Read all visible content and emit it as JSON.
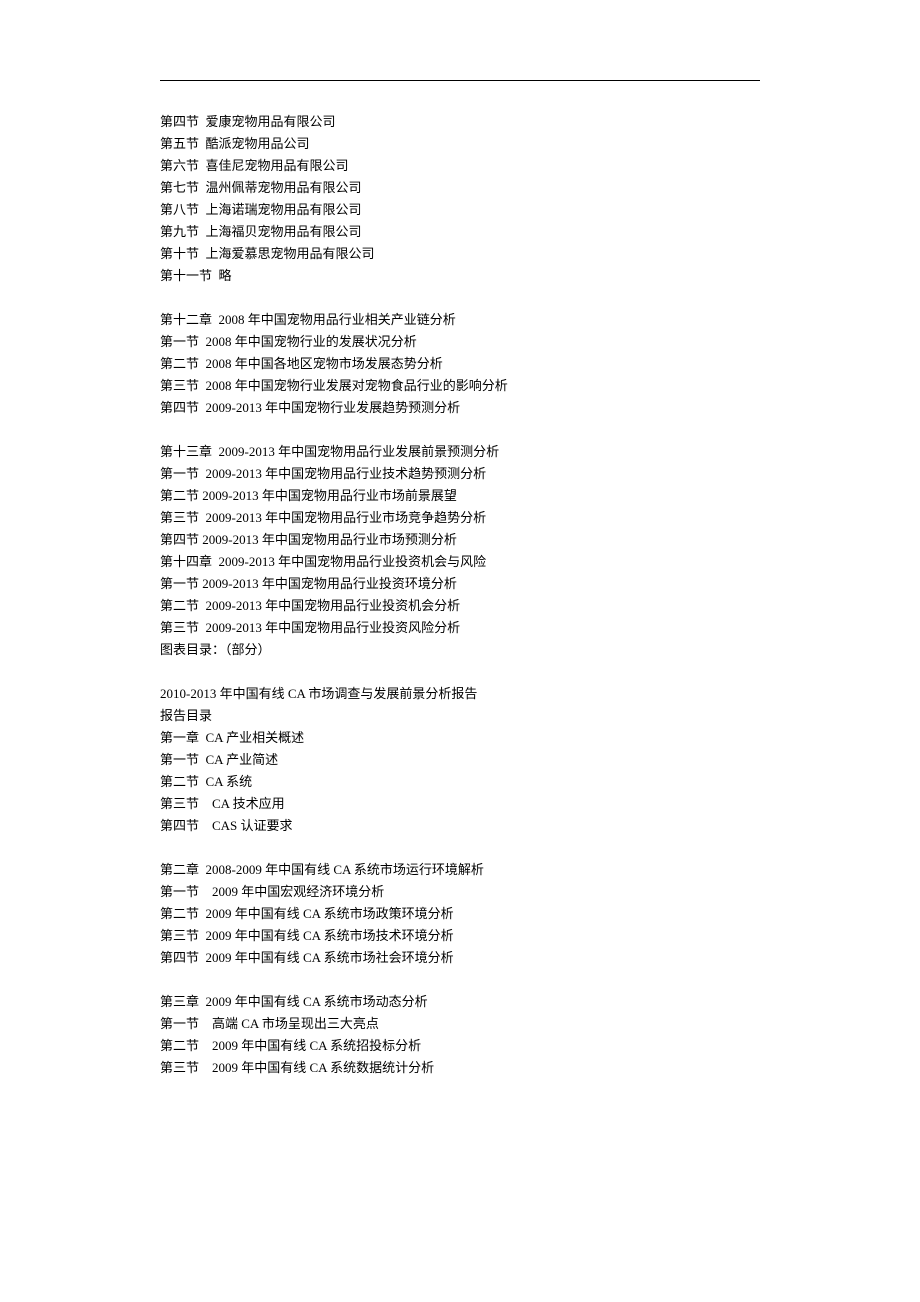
{
  "lines": [
    "第四节  爱康宠物用品有限公司",
    "第五节  酷派宠物用品公司",
    "第六节  喜佳尼宠物用品有限公司",
    "第七节  温州佩蒂宠物用品有限公司",
    "第八节  上海诺瑞宠物用品有限公司",
    "第九节  上海福贝宠物用品有限公司",
    "第十节  上海爱慕思宠物用品有限公司",
    "第十一节  略",
    "",
    "第十二章  2008 年中国宠物用品行业相关产业链分析",
    "第一节  2008 年中国宠物行业的发展状况分析",
    "第二节  2008 年中国各地区宠物市场发展态势分析",
    "第三节  2008 年中国宠物行业发展对宠物食品行业的影响分析",
    "第四节  2009-2013 年中国宠物行业发展趋势预测分析",
    "",
    "第十三章  2009-2013 年中国宠物用品行业发展前景预测分析",
    "第一节  2009-2013 年中国宠物用品行业技术趋势预测分析",
    "第二节 2009-2013 年中国宠物用品行业市场前景展望",
    "第三节  2009-2013 年中国宠物用品行业市场竞争趋势分析",
    "第四节 2009-2013 年中国宠物用品行业市场预测分析",
    "第十四章  2009-2013 年中国宠物用品行业投资机会与风险",
    "第一节 2009-2013 年中国宠物用品行业投资环境分析",
    "第二节  2009-2013 年中国宠物用品行业投资机会分析",
    "第三节  2009-2013 年中国宠物用品行业投资风险分析",
    "图表目录：（部分）",
    "",
    "2010-2013 年中国有线 CA 市场调查与发展前景分析报告",
    "报告目录",
    "第一章  CA 产业相关概述",
    "第一节  CA 产业简述",
    "第二节  CA 系统",
    "第三节    CA 技术应用",
    "第四节    CAS 认证要求",
    "",
    "第二章  2008-2009 年中国有线 CA 系统市场运行环境解析",
    "第一节    2009 年中国宏观经济环境分析",
    "第二节  2009 年中国有线 CA 系统市场政策环境分析",
    "第三节  2009 年中国有线 CA 系统市场技术环境分析",
    "第四节  2009 年中国有线 CA 系统市场社会环境分析",
    "",
    "第三章  2009 年中国有线 CA 系统市场动态分析",
    "第一节    高端 CA 市场呈现出三大亮点",
    "第二节    2009 年中国有线 CA 系统招投标分析",
    "第三节    2009 年中国有线 CA 系统数据统计分析"
  ]
}
